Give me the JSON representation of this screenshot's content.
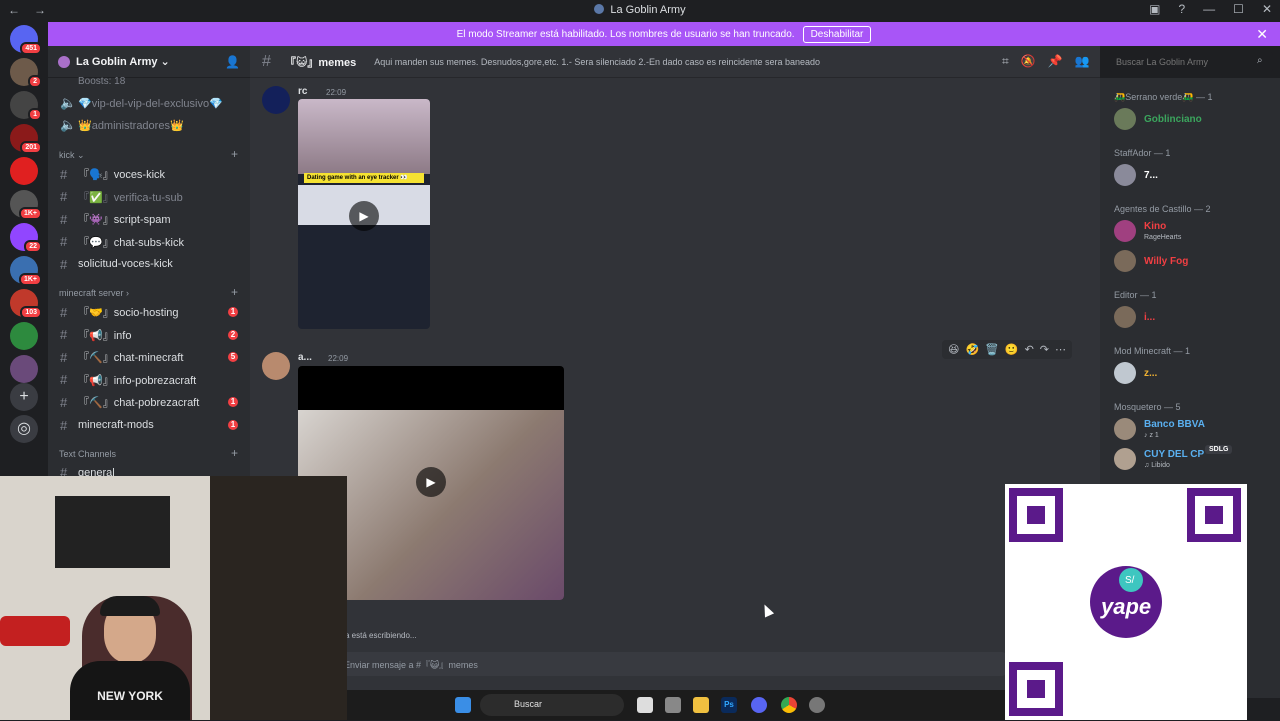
{
  "window": {
    "title": "La Goblin Army",
    "nav_back": "←",
    "nav_fwd": "→"
  },
  "banner": {
    "text": "El modo Streamer está habilitado. Los nombres de usuario se han truncado.",
    "button": "Deshabilitar",
    "close": "✕"
  },
  "servers": [
    {
      "badge": "451",
      "color": "#5865f2"
    },
    {
      "badge": "2",
      "color": "#6d5a4a"
    },
    {
      "badge": "1",
      "color": "#444"
    },
    {
      "badge": "201",
      "color": "#8b1a1a"
    },
    {
      "badge": "",
      "color": "#e02020"
    },
    {
      "badge": "1K+",
      "color": "#555"
    },
    {
      "badge": "22",
      "color": "#9146ff"
    },
    {
      "badge": "1K+",
      "color": "#3a6fb0"
    },
    {
      "badge": "103",
      "color": "#c0392b"
    },
    {
      "badge": "",
      "color": "#2d8a3e"
    },
    {
      "badge": "",
      "color": "#6a4a7a"
    }
  ],
  "server": {
    "name": "La Goblin Army ⌄",
    "boosts": "Boosts: 18"
  },
  "sidebar": {
    "top_channels": [
      {
        "name": "💎vip-del-vip-del-exclusivo💎"
      },
      {
        "name": "👑administradores👑"
      }
    ],
    "categories": [
      {
        "name": "kick ⌄",
        "channels": [
          {
            "name": "『🗣️』voces-kick",
            "muted": false,
            "badge": ""
          },
          {
            "name": "『✅』verifica-tu-sub",
            "muted": true,
            "badge": ""
          },
          {
            "name": "『👾』script-spam",
            "muted": false,
            "badge": ""
          },
          {
            "name": "『💬』chat-subs-kick",
            "muted": false,
            "badge": ""
          },
          {
            "name": "solicitud-voces-kick",
            "muted": false,
            "badge": ""
          }
        ]
      },
      {
        "name": "minecraft server ›",
        "channels": [
          {
            "name": "『🤝』socio-hosting",
            "muted": false,
            "badge": "1"
          },
          {
            "name": "『📢』info",
            "muted": false,
            "badge": "2"
          },
          {
            "name": "『⛏️』chat-minecraft",
            "muted": false,
            "badge": "5"
          },
          {
            "name": "『📢』info-pobrezacraft",
            "muted": false,
            "badge": ""
          },
          {
            "name": "『⛏️』chat-pobrezacraft",
            "muted": false,
            "badge": "1"
          },
          {
            "name": "minecraft-mods",
            "muted": false,
            "badge": "1"
          }
        ]
      },
      {
        "name": "Text Channels",
        "channels": [
          {
            "name": "general",
            "muted": false,
            "badge": ""
          }
        ]
      }
    ]
  },
  "channel": {
    "name": "『😺』memes",
    "topic": "Aqui manden sus memes. Desnudos,gore,etc. 1.- Sera silenciado 2.-En dado caso es reincidente sera baneado",
    "search_placeholder": "Buscar La Goblin Army"
  },
  "messages": [
    {
      "author": "rc",
      "time": "22:09",
      "color": "#3ba55d",
      "video_caption": "Dating game with an eye tracker 👀"
    },
    {
      "author": "a...",
      "time": "22:09",
      "color": "#f0b232"
    }
  ],
  "reactions": [
    "😆",
    "🤣",
    "🗑️",
    "🙂",
    "↶",
    "↷",
    "⋯"
  ],
  "typing": "a está escribiendo...",
  "composer_placeholder": "Enviar mensaje a #『😺』memes",
  "members": [
    {
      "role": "🛺Serrano verde🛺 — 1",
      "people": [
        {
          "name": "Goblinciano",
          "color": "#3ba55d",
          "sub": ""
        }
      ]
    },
    {
      "role": "StaffAdor — 1",
      "people": [
        {
          "name": "7...",
          "color": "#ffffff",
          "sub": ""
        }
      ]
    },
    {
      "role": "Agentes de Castillo — 2",
      "people": [
        {
          "name": "Kino",
          "color": "#f23f43",
          "sub": "RageHearts"
        },
        {
          "name": "Willy Fog",
          "color": "#f23f43",
          "sub": ""
        }
      ]
    },
    {
      "role": "Editor — 1",
      "people": [
        {
          "name": "i...",
          "color": "#f23f43",
          "sub": ""
        }
      ]
    },
    {
      "role": "Mod Minecraft — 1",
      "people": [
        {
          "name": "z...",
          "color": "#f0b232",
          "sub": ""
        }
      ]
    },
    {
      "role": "Mosquetero — 5",
      "people": [
        {
          "name": "Banco BBVA",
          "color": "#5ab0f0",
          "sub": "♪ z 1"
        },
        {
          "name": "CUY DEL CP",
          "color": "#5ab0f0",
          "sub": "♫ Libido"
        }
      ]
    }
  ],
  "member_tag": "SDLG",
  "overlay": {
    "qr_brand": "yape",
    "qr_symbol": "S/"
  },
  "webcam": {
    "shirt_text": "NEW YORK"
  },
  "taskbar": {
    "search": "Buscar"
  },
  "colors": {
    "accent": "#a855f7",
    "banner": "#a855f7",
    "danger": "#f23f43"
  }
}
